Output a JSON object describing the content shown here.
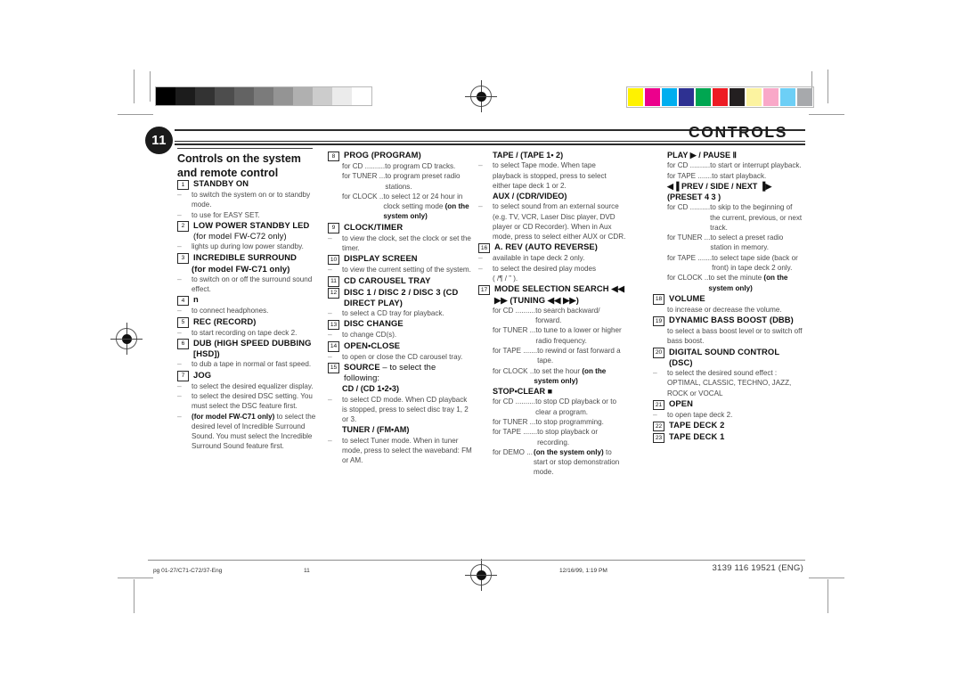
{
  "header": {
    "page_number": "11",
    "doc_title": "CONTROLS",
    "section_title": "Controls on the system and remote control"
  },
  "footer": {
    "file": "pg 01-27/C71-C72/37-Eng",
    "page": "11",
    "timestamp": "12/16/99, 1:19 PM",
    "doc_code": "3139 116 19521 (ENG)"
  },
  "calibration": {
    "grayscale": [
      "#000000",
      "#1c1c1c",
      "#333333",
      "#4d4d4d",
      "#636363",
      "#7b7b7b",
      "#949494",
      "#b0b0b0",
      "#cccccc",
      "#ebebeb",
      "#ffffff"
    ],
    "colors": [
      "#fff200",
      "#ec008c",
      "#00aeef",
      "#2e3192",
      "#00a651",
      "#ed1c24",
      "#231f20",
      "#fcf3a0",
      "#f9a8c8",
      "#6dcff6",
      "#a7a9ac"
    ]
  },
  "columns": [
    {
      "id": "col1",
      "entries": [
        {
          "num": "1",
          "title": "STANDBY ON",
          "lines": [
            {
              "t": "dash",
              "text": "to switch the system on or to standby mode."
            },
            {
              "t": "dash",
              "text": "to use for EASY SET."
            }
          ]
        },
        {
          "num": "2",
          "title": "LOW POWER STANDBY LED",
          "title_light": " (for model FW-C72 only)",
          "lines": [
            {
              "t": "dash",
              "text": "lights up during low power standby."
            }
          ]
        },
        {
          "num": "3",
          "title": "INCREDIBLE SURROUND",
          "title_light2": "(for model FW-C71 only)",
          "lines": [
            {
              "t": "dash",
              "text": "to switch on or off the surround sound effect."
            }
          ]
        },
        {
          "num": "4",
          "title": "n",
          "lines": [
            {
              "t": "dash",
              "text": "to connect headphones."
            }
          ]
        },
        {
          "num": "5",
          "title": "REC (RECORD)",
          "lines": [
            {
              "t": "dash",
              "text": "to start recording on tape deck 2."
            }
          ]
        },
        {
          "num": "6",
          "title": "DUB (HIGH SPEED DUBBING [HSD])",
          "lines": [
            {
              "t": "dash",
              "text": "to dub a tape in normal or fast speed."
            }
          ]
        },
        {
          "num": "7",
          "title": "JOG",
          "lines": [
            {
              "t": "dash",
              "text": "to select the desired equalizer display."
            },
            {
              "t": "dash",
              "text": "to select the desired DSC setting. You must select the DSC feature first."
            },
            {
              "t": "dash",
              "bold_head": "(for model FW-C71 only)",
              "text": "to select the desired level of Incredible Surround Sound. You must select the Incredible Surround Sound feature first."
            }
          ]
        }
      ]
    },
    {
      "id": "col2",
      "entries": [
        {
          "num": "8",
          "title": "PROG (PROGRAM)",
          "forrows": [
            {
              "label": "for CD ..........",
              "text": "to program CD tracks."
            },
            {
              "label": "for TUNER ...",
              "text": "to program preset radio stations."
            },
            {
              "label": "for CLOCK ..",
              "text": "to select 12 or 24 hour in clock setting mode ",
              "bold_tail": "(on the system only)"
            }
          ]
        },
        {
          "num": "9",
          "title": "CLOCK/TIMER",
          "lines": [
            {
              "t": "dash",
              "text": "to view the clock, set the clock or set the timer."
            }
          ]
        },
        {
          "num": "10",
          "title": "DISPLAY SCREEN",
          "lines": [
            {
              "t": "dash",
              "text": "to view the current setting of the system."
            }
          ]
        },
        {
          "num": "11",
          "title": "CD CAROUSEL TRAY",
          "lines": []
        },
        {
          "num": "12",
          "title": "DISC 1 / DISC 2 / DISC 3 (CD DIRECT PLAY)",
          "lines": [
            {
              "t": "dash",
              "text": "to select a CD tray for playback."
            }
          ]
        },
        {
          "num": "13",
          "title": "DISC CHANGE",
          "lines": [
            {
              "t": "dash",
              "text": "to change CD(s)."
            }
          ]
        },
        {
          "num": "14",
          "title": "OPEN•CLOSE",
          "lines": [
            {
              "t": "dash",
              "text": "to open or close the CD carousel tray."
            }
          ]
        },
        {
          "num": "15",
          "title": "SOURCE",
          "title_light": " – to select the following:",
          "lines": []
        },
        {
          "sub": "CD / (CD 1•2•3)",
          "lines": [
            {
              "t": "dash",
              "text": "to select CD mode. When CD playback is stopped, press to select disc tray 1, 2 or 3."
            }
          ]
        },
        {
          "sub": "TUNER / (FM•AM)",
          "lines": [
            {
              "t": "dash",
              "text": "to select Tuner mode. When in tuner mode, press to select the waveband: FM or AM."
            }
          ]
        }
      ]
    },
    {
      "id": "col3",
      "entries": [
        {
          "sub": "TAPE / (TAPE 1• 2)",
          "lines": [
            {
              "t": "dash",
              "text": "to select Tape mode. When tape playback is stopped, press to select either tape deck 1 or 2."
            }
          ]
        },
        {
          "sub": "AUX / (CDR/VIDEO)",
          "lines": [
            {
              "t": "dash",
              "text": "to select sound from an external source (e.g. TV, VCR, Laser Disc player, DVD player or CD Recorder). When in Aux mode, press to select either AUX or CDR."
            }
          ]
        },
        {
          "num": "16",
          "title": "A. REV (AUTO REVERSE)",
          "lines": [
            {
              "t": "dash",
              "text": "available in tape deck 2 only."
            },
            {
              "t": "dash",
              "text": "to select the desired play modes"
            },
            {
              "t": "plain",
              "text": "(     /¶  / ”      )."
            }
          ]
        },
        {
          "num": "17",
          "title": "MODE SELECTION SEARCH ◀◀    ▶▶ (TUNING ◀◀   ▶▶)",
          "forrows": [
            {
              "label": "for CD ..........",
              "text": "to search backward/ forward."
            },
            {
              "label": "for TUNER ...",
              "text": "to tune to a lower or higher radio frequency."
            },
            {
              "label": "for TAPE .......",
              "text": "to rewind or fast forward a tape."
            },
            {
              "label": "for CLOCK ..",
              "text": "to set the hour ",
              "bold_tail": "(on the system only)"
            }
          ]
        },
        {
          "sub": "STOP•CLEAR  ■",
          "forrows": [
            {
              "label": "for CD ..........",
              "text": "to stop CD playback or to clear a program."
            },
            {
              "label": "for TUNER ...",
              "text": "to stop programming."
            },
            {
              "label": "for TAPE .......",
              "text": "to stop playback or recording."
            },
            {
              "label": "for DEMO ...",
              "bold_lead": "(on the system only)",
              "text": "to start or stop demonstration mode."
            }
          ]
        }
      ]
    },
    {
      "id": "col4",
      "entries": [
        {
          "sub": "PLAY ▶ / PAUSE Ⅱ",
          "forrows": [
            {
              "label": "for CD ..........",
              "text": "to start or interrupt playback."
            },
            {
              "label": "for TAPE .......",
              "text": "to start playback."
            }
          ]
        },
        {
          "sub": "◀▐ PREV / SIDE / NEXT ▐▶ (PRESET 4 3  )",
          "forrows": [
            {
              "label": "for CD ..........",
              "text": "to skip to the beginning of the current, previous, or next track."
            },
            {
              "label": "for TUNER ...",
              "text": "to select a preset radio station in memory."
            },
            {
              "label": "for TAPE .......",
              "text": "to select tape side (back or front) in tape deck 2 only."
            },
            {
              "label": "for CLOCK ..",
              "text": "to set the minute ",
              "bold_tail": "(on the system only)"
            }
          ]
        },
        {
          "num": "18",
          "title": "VOLUME",
          "lines": [
            {
              "t": "plain",
              "text": "to increase or decrease the volume."
            }
          ]
        },
        {
          "num": "19",
          "title": "DYNAMIC BASS BOOST (DBB)",
          "lines": [
            {
              "t": "plain",
              "text": "to select a bass boost level or to switch off bass boost."
            }
          ]
        },
        {
          "num": "20",
          "title": "DIGITAL SOUND CONTROL  (DSC)",
          "lines": [
            {
              "t": "dash",
              "text": "to select the desired sound effect : OPTIMAL, CLASSIC, TECHNO, JAZZ, ROCK or VOCAL"
            }
          ]
        },
        {
          "num": "21",
          "title": "OPEN",
          "lines": [
            {
              "t": "dash",
              "text": "to open tape deck 2."
            }
          ]
        },
        {
          "num": "22",
          "title": "TAPE DECK 2",
          "lines": []
        },
        {
          "num": "23",
          "title": "TAPE DECK 1",
          "lines": []
        }
      ]
    }
  ]
}
